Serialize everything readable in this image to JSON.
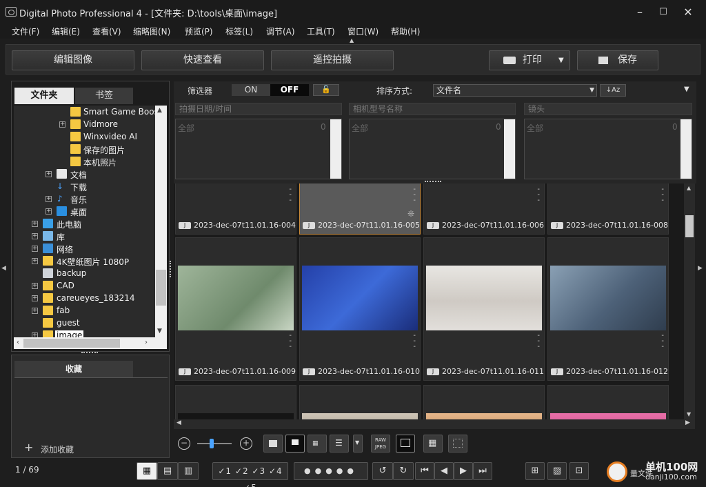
{
  "window": {
    "title": "Digital Photo Professional 4 - [文件夹: D:\\tools\\桌面\\image]",
    "minimize": "–",
    "maximize": "☐",
    "close": "✕"
  },
  "menu": [
    "文件(F)",
    "编辑(E)",
    "查看(V)",
    "缩略图(N)",
    "预览(P)",
    "标签(L)",
    "调节(A)",
    "工具(T)",
    "窗口(W)",
    "帮助(H)"
  ],
  "toolbar": {
    "edit_image": "编辑图像",
    "quick_view": "快速查看",
    "remote_shoot": "遥控拍摄",
    "print": "打印",
    "save": "保存"
  },
  "left_panel": {
    "tab_folder": "文件夹",
    "tab_bookmark": "书签",
    "tree": [
      "Smart Game Booste",
      "Vidmore",
      "Winxvideo AI",
      "保存的图片",
      "本机照片",
      "文档",
      "下载",
      "音乐",
      "桌面",
      "此电脑",
      "库",
      "网络",
      "4K壁纸图片 1080P",
      "backup",
      "CAD",
      "careueyes_183214",
      "fab",
      "guest",
      "image"
    ],
    "favorites_title": "收藏",
    "add_favorite": "添加收藏"
  },
  "filter": {
    "label": "筛选器",
    "on": "ON",
    "off": "OFF",
    "sort_label": "排序方式:",
    "sort_value": "文件名",
    "date_placeholder": "拍摄日期/时间",
    "camera_placeholder": "相机型号名称",
    "lens_placeholder": "镜头",
    "all": "全部",
    "count": "0"
  },
  "thumbnails": [
    {
      "name": "2023-dec-07t11.01.16-004...",
      "selected": false,
      "color": "#1f1f1f"
    },
    {
      "name": "2023-dec-07t11.01.16-005...",
      "selected": true,
      "color": "#5a5a5a"
    },
    {
      "name": "2023-dec-07t11.01.16-006...",
      "selected": false,
      "color": "#1f1f1f"
    },
    {
      "name": "2023-dec-07t11.01.16-008...",
      "selected": false,
      "color": "#1f1f1f"
    },
    {
      "name": "2023-dec-07t11.01.16-009...",
      "selected": false,
      "color": "#8fa88a"
    },
    {
      "name": "2023-dec-07t11.01.16-010...",
      "selected": false,
      "color": "#3552b8"
    },
    {
      "name": "2023-dec-07t11.01.16-011...",
      "selected": false,
      "color": "#d9d6d2"
    },
    {
      "name": "2023-dec-07t11.01.16-012...",
      "selected": false,
      "color": "#5a6f86"
    }
  ],
  "raw_jpeg": "RAW JPEG",
  "status": {
    "page": "1 / 69",
    "ratings": [
      "1",
      "2",
      "3",
      "4",
      "5"
    ],
    "watermark": "单机100网",
    "watermark_url": "danji100.com",
    "watermark_extra": "量文件"
  },
  "badge_j": "J"
}
